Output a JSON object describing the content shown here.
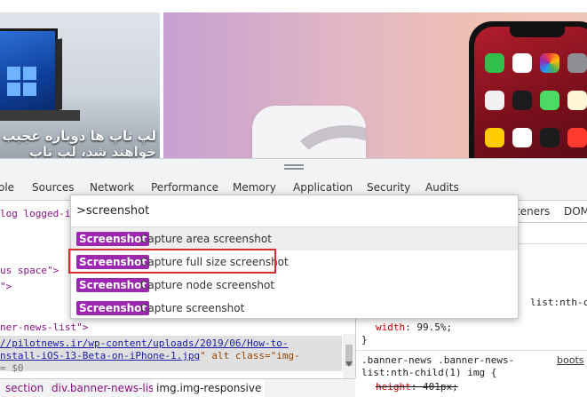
{
  "webpage": {
    "news_caption_line1": "لپ تاپ ها دوباره عجیب",
    "news_caption_line2": "خواهند شد، لپ تاپ های"
  },
  "devtools": {
    "tabs": [
      "ole",
      "Sources",
      "Network",
      "Performance",
      "Memory",
      "Application",
      "Security",
      "Audits"
    ],
    "right_tabs": [
      "teners",
      "DOM"
    ],
    "command_menu": {
      "query": ">screenshot",
      "items": [
        {
          "badge": "Screenshot",
          "title": "Capture area screenshot"
        },
        {
          "badge": "Screenshot",
          "title": "Capture full size screenshot"
        },
        {
          "badge": "Screenshot",
          "title": "Capture node screenshot"
        },
        {
          "badge": "Screenshot",
          "title": "Capture screenshot"
        }
      ]
    },
    "elements": {
      "line1": "log logged-in",
      "line2": "us space\">",
      "line3": "\">",
      "line4": "ner-news-list\">",
      "line5": "//pilotnews.ir/wp-content/uploads/2019/06/How-to-",
      "line6_link": "nstall-iOS-13-Beta-on-iPhone-1.jpg",
      "line6_rest": "\" alt class=\"img-",
      "line7": "= $0"
    },
    "breadcrumb": [
      "section",
      "div.banner-news-list",
      "img.img-responsive"
    ],
    "styles": {
      "rule1_selector": "list:nth-chil",
      "rule1_prop_name": "width",
      "rule1_prop_value": "99.5%;",
      "rule1_close": "}",
      "rule2_selector_line1": ".banner-news .banner-news-",
      "rule2_selector_line2": "list:nth-child(1) img {",
      "rule2_source": "boots",
      "rule2_prop_name": "height",
      "rule2_prop_value": "401px;"
    }
  },
  "colors": {
    "badge": "#9c27b0",
    "highlight": "#d32f2f"
  }
}
